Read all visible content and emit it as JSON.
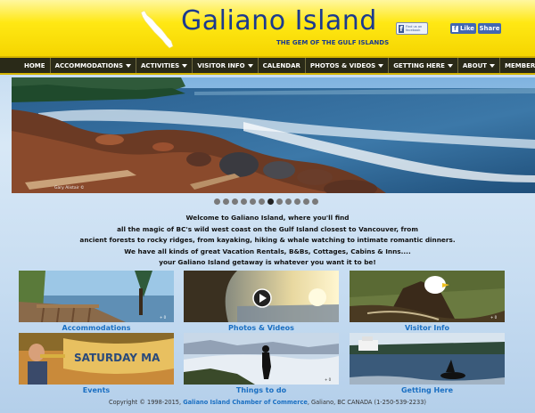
{
  "header": {
    "title": "Galiano Island",
    "tagline": "THE GEM OF THE GULF ISLANDS",
    "fb_find_text": "Find us on facebook",
    "fb_like": "Like",
    "fb_share": "Share"
  },
  "nav": {
    "items": [
      {
        "label": "HOME",
        "dropdown": false
      },
      {
        "label": "ACCOMMODATIONS",
        "dropdown": true
      },
      {
        "label": "ACTIVITIES",
        "dropdown": true
      },
      {
        "label": "VISITOR INFO",
        "dropdown": true
      },
      {
        "label": "CALENDAR",
        "dropdown": false
      },
      {
        "label": "PHOTOS & VIDEOS",
        "dropdown": true
      },
      {
        "label": "GETTING HERE",
        "dropdown": true
      },
      {
        "label": "ABOUT",
        "dropdown": true
      },
      {
        "label": "MEMBER LOGIN",
        "dropdown": false
      }
    ]
  },
  "hero": {
    "credit": "Gary Alistair ©",
    "slide_count": 12,
    "active_slide": 7
  },
  "intro": {
    "lines": [
      "Welcome to Galiano Island, where you'll find",
      "all the magic of BC's wild west coast on the Gulf Island closest to Vancouver, from",
      "ancient forests to rocky ridges, from kayaking, hiking & whale watching to intimate romantic dinners.",
      "We have all kinds of great Vacation Rentals, B&Bs, Cottages, Cabins & Inns....",
      "your Galiano Island getaway is whatever you want it to be!"
    ]
  },
  "tiles": {
    "accommodations": "Accommodations",
    "photos_videos": "Photos & Videos",
    "visitor_info": "Visitor Info",
    "events": "Events",
    "things_to_do": "Things to do",
    "getting_here": "Getting Here",
    "events_banner_text": "SATURDAY MA"
  },
  "footer": {
    "prefix": "Copyright © 1998-2015,",
    "link": "Galiano Island Chamber of Commerce",
    "suffix": ", Galiano, BC CANADA (1-250-539-2233)"
  }
}
